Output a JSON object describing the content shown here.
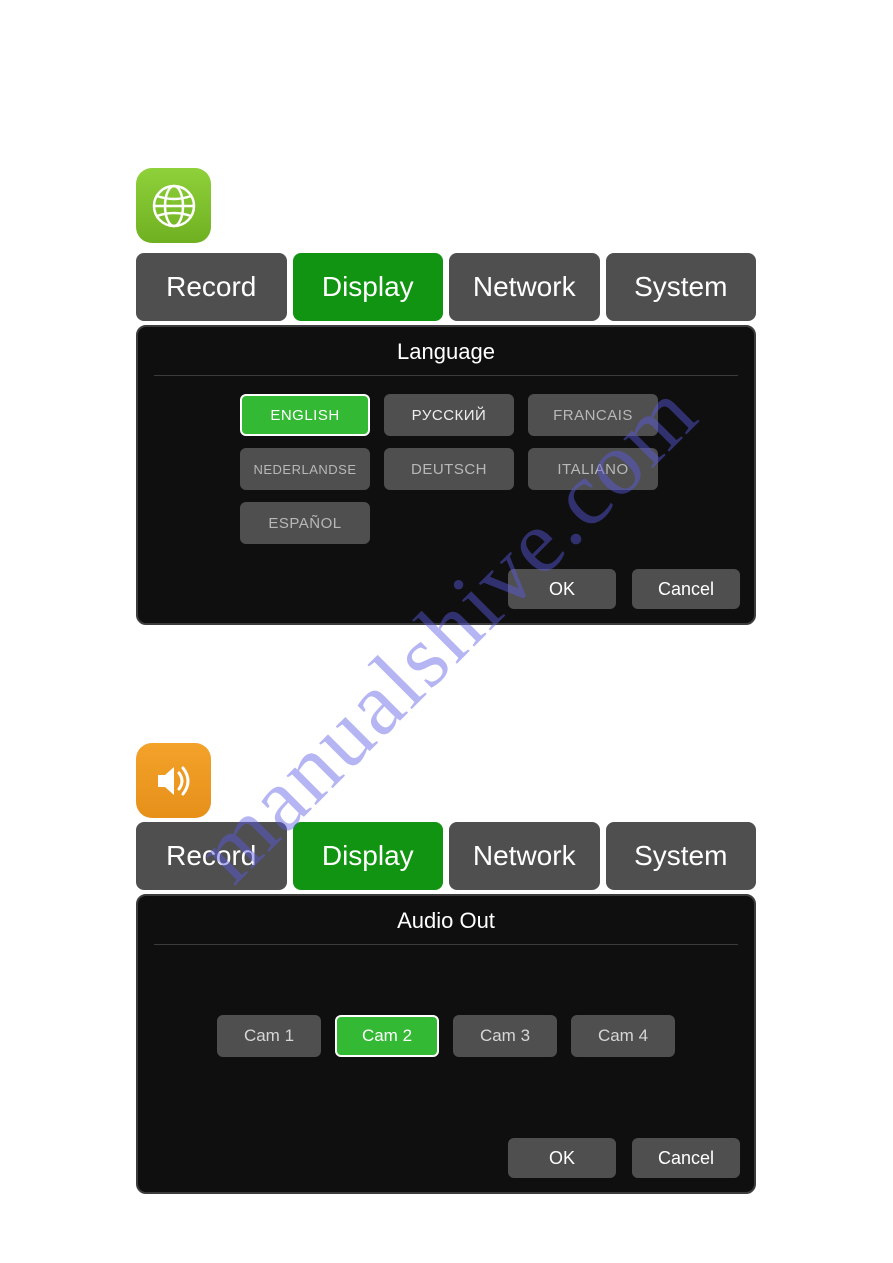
{
  "watermark": "manualshive.com",
  "tabs": {
    "record": "Record",
    "display": "Display",
    "network": "Network",
    "system": "System"
  },
  "panel1": {
    "title": "Language",
    "options": {
      "english": "ENGLISH",
      "russian": "РУССКИЙ",
      "francais": "FRANCAIS",
      "nederlandse": "NEDERLANDSE",
      "deutsch": "DEUTSCH",
      "italiano": "ITALIANO",
      "espanol": "ESPAÑOL"
    },
    "ok": "OK",
    "cancel": "Cancel"
  },
  "panel2": {
    "title": "Audio Out",
    "cams": {
      "cam1": "Cam 1",
      "cam2": "Cam 2",
      "cam3": "Cam 3",
      "cam4": "Cam 4"
    },
    "ok": "OK",
    "cancel": "Cancel"
  }
}
